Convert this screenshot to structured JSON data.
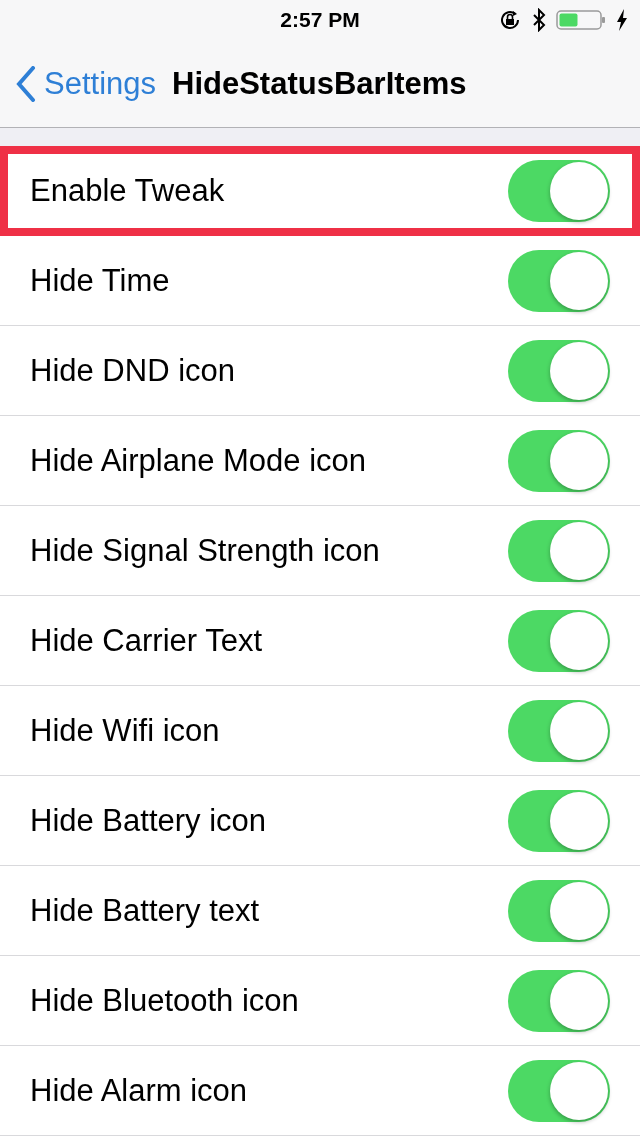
{
  "status_bar": {
    "time": "2:57 PM"
  },
  "nav": {
    "back_label": "Settings",
    "title": "HideStatusBarItems"
  },
  "options": [
    {
      "label": "Enable Tweak",
      "on": true,
      "highlighted": true
    },
    {
      "label": "Hide Time",
      "on": true,
      "highlighted": false
    },
    {
      "label": "Hide DND icon",
      "on": true,
      "highlighted": false
    },
    {
      "label": "Hide Airplane Mode icon",
      "on": true,
      "highlighted": false
    },
    {
      "label": "Hide Signal Strength icon",
      "on": true,
      "highlighted": false
    },
    {
      "label": "Hide Carrier Text",
      "on": true,
      "highlighted": false
    },
    {
      "label": "Hide Wifi icon",
      "on": true,
      "highlighted": false
    },
    {
      "label": "Hide Battery icon",
      "on": true,
      "highlighted": false
    },
    {
      "label": "Hide Battery text",
      "on": true,
      "highlighted": false
    },
    {
      "label": "Hide Bluetooth icon",
      "on": true,
      "highlighted": false
    },
    {
      "label": "Hide Alarm icon",
      "on": true,
      "highlighted": false
    }
  ]
}
